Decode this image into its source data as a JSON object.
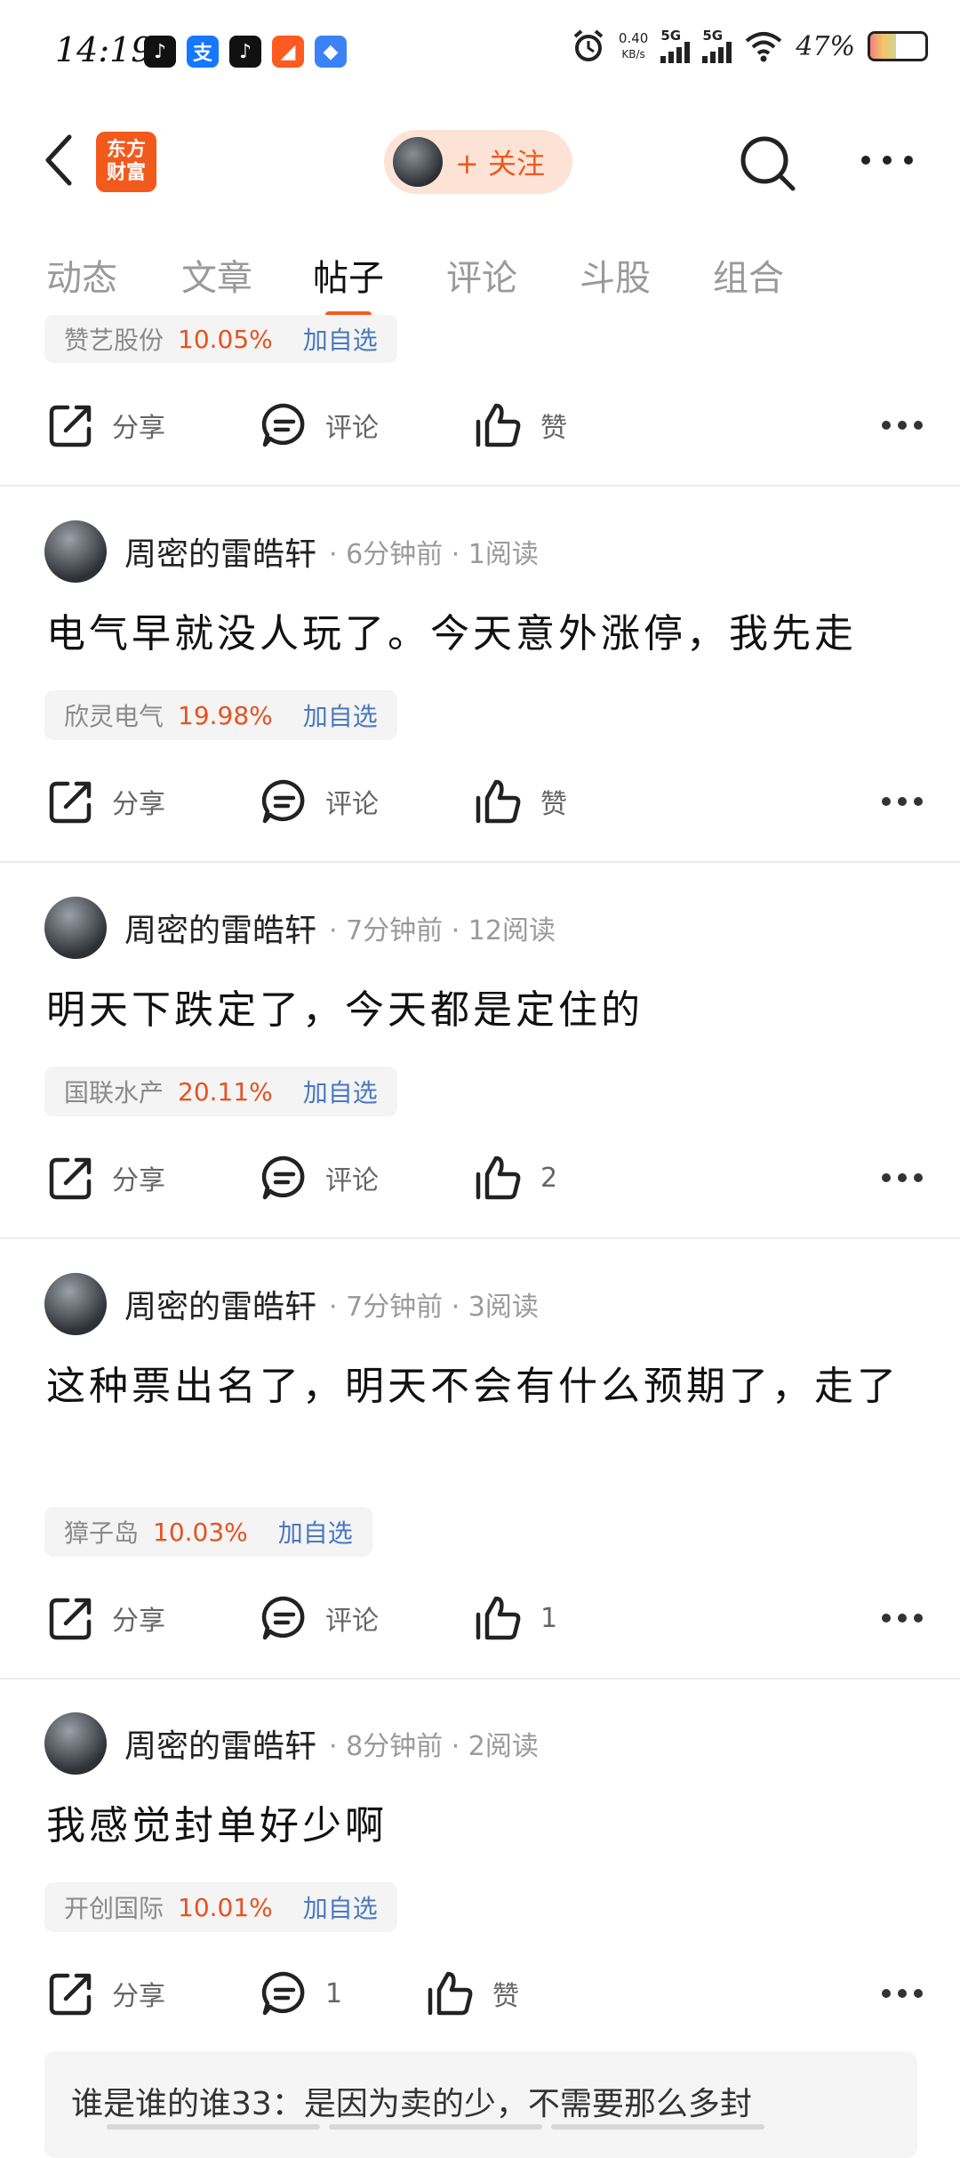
{
  "status_bar": {
    "time": "14:19",
    "net_speed_value": "0.40",
    "net_speed_unit": "KB/s",
    "signal_1": "5G",
    "signal_2": "5G",
    "battery_pct": "47%",
    "battery_level": 0.47,
    "app_icons": [
      "tiktok-icon",
      "alipay-icon",
      "tiktok-icon",
      "app-orange-icon",
      "app-blue-icon"
    ]
  },
  "header": {
    "logo_text": "东方\n财富",
    "follow_label": "+ 关注"
  },
  "tabs": [
    {
      "label": "动态",
      "active": false
    },
    {
      "label": "文章",
      "active": false
    },
    {
      "label": "帖子",
      "active": true
    },
    {
      "label": "评论",
      "active": false
    },
    {
      "label": "斗股",
      "active": false
    },
    {
      "label": "组合",
      "active": false
    }
  ],
  "colors": {
    "accent": "#f25a1c",
    "up": "#e6521f",
    "link": "#4a79c0"
  },
  "posts": [
    {
      "chip": {
        "name": "赞艺股份",
        "pct": "10.05%",
        "add": "加自选"
      },
      "actions": {
        "share": "分享",
        "comment": "评论",
        "like": "赞"
      }
    },
    {
      "author": "周密的雷皓轩",
      "meta": "· 6分钟前 · 1阅读",
      "text": "电气早就没人玩了。今天意外涨停，我先走",
      "chip": {
        "name": "欣灵电气",
        "pct": "19.98%",
        "add": "加自选"
      },
      "actions": {
        "share": "分享",
        "comment": "评论",
        "like": "赞"
      }
    },
    {
      "author": "周密的雷皓轩",
      "meta": "· 7分钟前 · 12阅读",
      "text": "明天下跌定了，今天都是定住的",
      "chip": {
        "name": "国联水产",
        "pct": "20.11%",
        "add": "加自选"
      },
      "actions": {
        "share": "分享",
        "comment": "评论",
        "like": "2"
      }
    },
    {
      "author": "周密的雷皓轩",
      "meta": "· 7分钟前 · 3阅读",
      "text": "这种票出名了，明天不会有什么预期了，走了",
      "chip": {
        "name": "獐子岛",
        "pct": "10.03%",
        "add": "加自选"
      },
      "actions": {
        "share": "分享",
        "comment": "评论",
        "like": "1"
      }
    },
    {
      "author": "周密的雷皓轩",
      "meta": "· 8分钟前 · 2阅读",
      "text": "我感觉封单好少啊",
      "chip": {
        "name": "开创国际",
        "pct": "10.01%",
        "add": "加自选"
      },
      "actions": {
        "share": "分享",
        "comment": "1",
        "like": "赞"
      }
    }
  ],
  "comment_preview": {
    "user": "谁是谁的谁33：",
    "text": "是因为卖的少，不需要那么多封"
  }
}
